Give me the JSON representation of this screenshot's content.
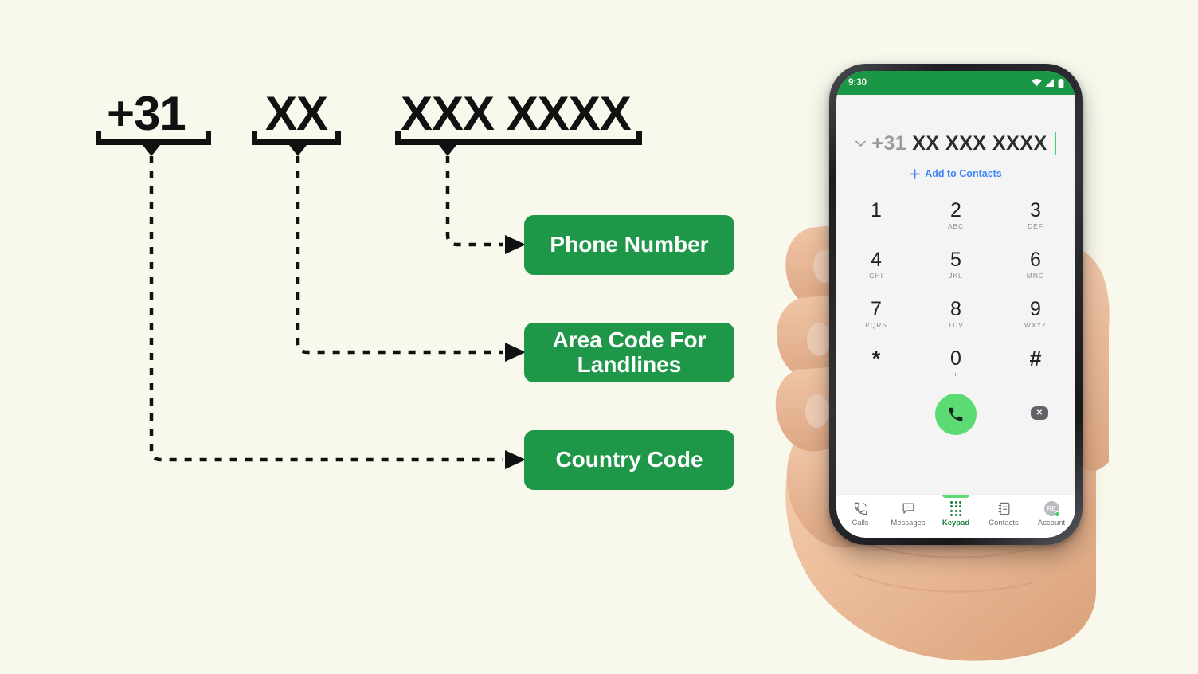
{
  "background_color": "#F8F8EC",
  "accent_green": "#1E9749",
  "diagram": {
    "segments": [
      {
        "id": "country",
        "text": "+31"
      },
      {
        "id": "area",
        "text": "XX"
      },
      {
        "id": "subscriber",
        "text": "XXX XXXX"
      }
    ],
    "callouts": [
      {
        "id": "phone-number",
        "label": "Phone Number",
        "source_segment": "subscriber"
      },
      {
        "id": "area-code",
        "label": "Area Code For Landlines",
        "source_segment": "area"
      },
      {
        "id": "country-code",
        "label": "Country Code",
        "source_segment": "country"
      }
    ]
  },
  "phone": {
    "statusbar": {
      "time": "9:30",
      "icons": [
        "wifi-icon",
        "signal-icon",
        "battery-icon"
      ]
    },
    "dialer": {
      "country_prefix": "+31",
      "number": "XX XXX XXXX",
      "chevron": "chevron-down-icon",
      "add_to_contacts": "Add to Contacts",
      "add_icon": "plus-icon",
      "caret_color": "#3ED36B"
    },
    "keypad": [
      {
        "digit": "1",
        "letters": ""
      },
      {
        "digit": "2",
        "letters": "ABC"
      },
      {
        "digit": "3",
        "letters": "DEF"
      },
      {
        "digit": "4",
        "letters": "GHI"
      },
      {
        "digit": "5",
        "letters": "JKL"
      },
      {
        "digit": "6",
        "letters": "MNO"
      },
      {
        "digit": "7",
        "letters": "PQRS"
      },
      {
        "digit": "8",
        "letters": "TUV"
      },
      {
        "digit": "9",
        "letters": "WXYZ"
      },
      {
        "digit": "*",
        "letters": ""
      },
      {
        "digit": "0",
        "letters": "+"
      },
      {
        "digit": "#",
        "letters": ""
      }
    ],
    "actions": {
      "call_icon": "phone-handset-icon",
      "call_color": "#5CDB75",
      "backspace_icon": "backspace-icon",
      "backspace_glyph": "✕"
    },
    "bottom_nav": [
      {
        "id": "calls",
        "label": "Calls",
        "icon": "phone-outgoing-icon",
        "active": false
      },
      {
        "id": "messages",
        "label": "Messages",
        "icon": "message-bubble-icon",
        "active": false
      },
      {
        "id": "keypad",
        "label": "Keypad",
        "icon": "dialpad-icon",
        "active": true
      },
      {
        "id": "contacts",
        "label": "Contacts",
        "icon": "contacts-book-icon",
        "active": false
      },
      {
        "id": "account",
        "label": "Account",
        "icon": "avatar-icon",
        "avatar_initials": "RE",
        "active": false
      }
    ]
  }
}
